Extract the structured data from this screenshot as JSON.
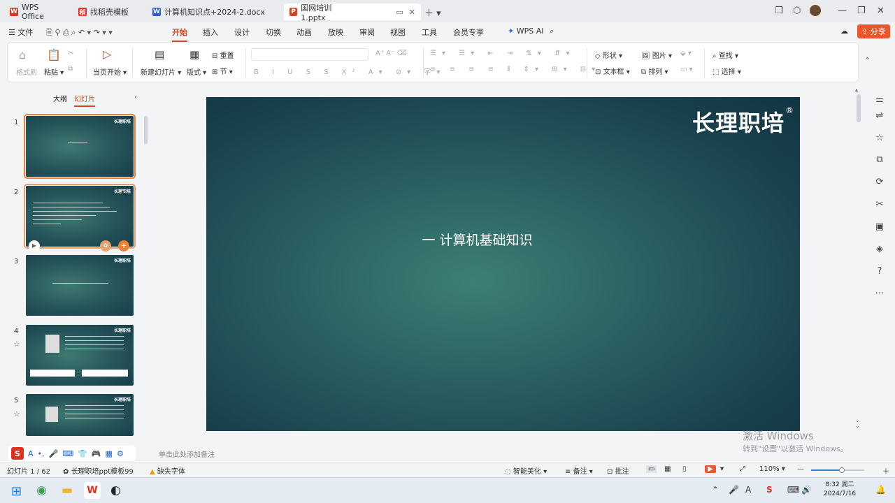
{
  "tabs": [
    {
      "label": "WPS Office",
      "icon": "wps-logo-icon",
      "color": "#e0301e"
    },
    {
      "label": "找稻壳模板",
      "icon": "docer-icon",
      "color": "#e0301e"
    },
    {
      "label": "计算机知识点+2024-2.docx",
      "icon": "word-doc-icon",
      "color": "#2b5cd8"
    },
    {
      "label": "国网培训1.pptx",
      "icon": "ppt-doc-icon",
      "color": "#d24726"
    }
  ],
  "menu": {
    "file": "文件",
    "items": [
      "开始",
      "插入",
      "设计",
      "切换",
      "动画",
      "放映",
      "审阅",
      "视图",
      "工具",
      "会员专享"
    ],
    "active": "开始",
    "wps_ai": "WPS AI",
    "share": "分享"
  },
  "ribbon": {
    "format_painter": "格式刷",
    "paste": "粘贴",
    "from_current": "当页开始",
    "new_slide": "新建幻灯片",
    "layout": "版式",
    "reset": "重置",
    "section": "节",
    "shape": "形状",
    "picture": "图片",
    "textbox": "文本框",
    "arrange": "排列",
    "find": "查找",
    "select": "选择"
  },
  "leftpanel": {
    "outline_tab": "大纲",
    "slides_tab": "幻灯片",
    "slide_numbers": [
      "1",
      "2",
      "3",
      "4",
      "5"
    ],
    "thumb_brand": "长理职培"
  },
  "slide": {
    "brand": "长理职培",
    "registered": "®",
    "title": "一  计算机基础知识"
  },
  "notes_placeholder": "单击此处添加备注",
  "status": {
    "slide_counter": "幻灯片 1 / 62",
    "template": "长理职培ppt模板99",
    "missing_font": "缺失字体",
    "smart_beautify": "智能美化",
    "notes": "备注",
    "comment": "批注",
    "zoom": "110%"
  },
  "watermark": {
    "line1": "激活 Windows",
    "line2": "转到\"设置\"以激活 Windows。"
  },
  "taskbar": {
    "time": "8:32 周二",
    "date": "2024/7/16"
  },
  "colors": {
    "accent": "#d24726",
    "slide_bg": "#1f4f57"
  }
}
